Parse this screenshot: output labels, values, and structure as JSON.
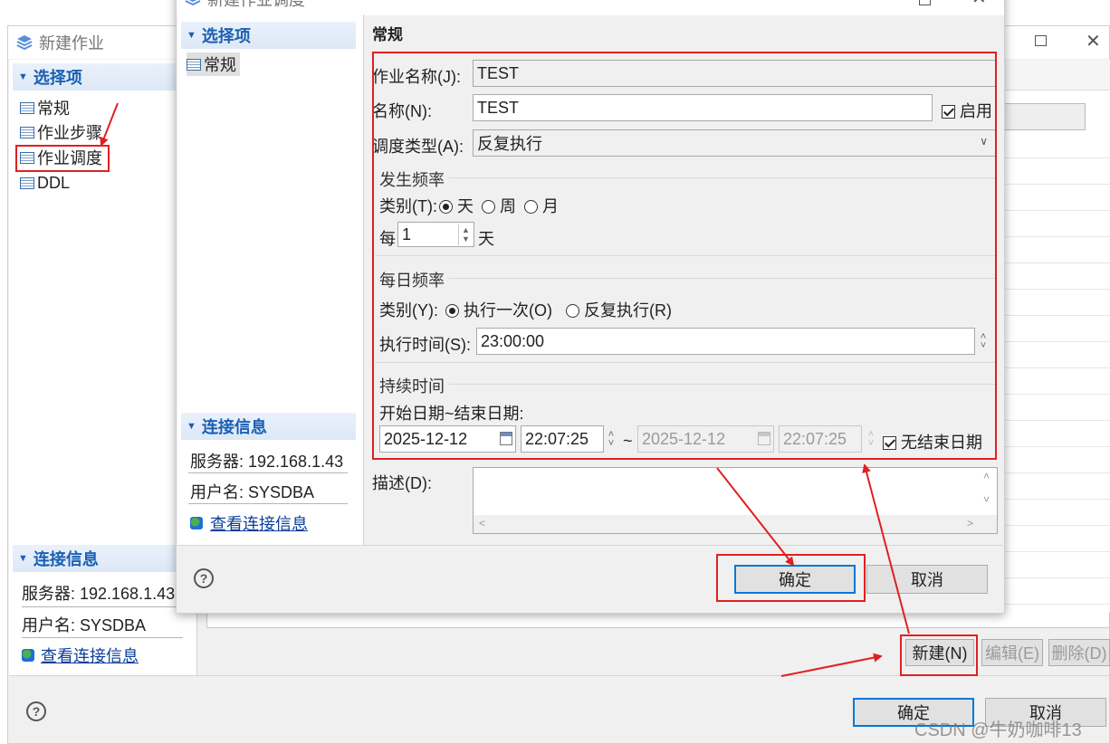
{
  "back_window": {
    "title": "新建作业",
    "nav_header": "选择项",
    "nav_items": [
      {
        "label": "常规"
      },
      {
        "label": "作业步骤"
      },
      {
        "label": "作业调度"
      },
      {
        "label": "DDL"
      }
    ],
    "conn_header": "连接信息",
    "server": "服务器: 192.168.1.43",
    "user": "用户名: SYSDBA",
    "view_conn": "查看连接信息",
    "buttons": {
      "new": "新建(N)",
      "edit": "编辑(E)",
      "delete": "删除(D)"
    },
    "ok": "确定",
    "cancel": "取消",
    "help": "?"
  },
  "dialog": {
    "title": "新建作业调度",
    "nav_header": "选择项",
    "nav_item": "常规",
    "conn_header": "连接信息",
    "server": "服务器: 192.168.1.43",
    "user": "用户名: SYSDBA",
    "view_conn": "查看连接信息",
    "section_title": "常规",
    "job_name_label": "作业名称(J):",
    "job_name_value": "TEST",
    "name_label": "名称(N):",
    "name_value": "TEST",
    "enable_label": "启用",
    "sched_type_label": "调度类型(A):",
    "sched_type_value": "反复执行",
    "freq_group": "发生频率",
    "freq_kind_label": "类别(T):",
    "freq_opt_day": "天",
    "freq_opt_week": "周",
    "freq_opt_month": "月",
    "every_prefix": "每",
    "every_value": "1",
    "every_unit": "天",
    "daily_group": "每日频率",
    "daily_kind_label": "类别(Y):",
    "daily_opt_once": "执行一次(O)",
    "daily_opt_repeat": "反复执行(R)",
    "exec_time_label": "执行时间(S):",
    "exec_time_value": "23:00:00",
    "duration_group": "持续时间",
    "date_range_label": "开始日期~结束日期:",
    "start_date": "2025-12-12",
    "start_time": "22:07:25",
    "tilde": "~",
    "end_date": "2025-12-12",
    "end_time": "22:07:25",
    "no_end_label": "无结束日期",
    "desc_label": "描述(D):",
    "ok": "确定",
    "cancel": "取消",
    "help": "?"
  },
  "watermark": "CSDN @牛奶咖啡13",
  "colors": {
    "accent": "#1a5fb4",
    "annotation": "#e02020",
    "primary_border": "#0078d7"
  }
}
